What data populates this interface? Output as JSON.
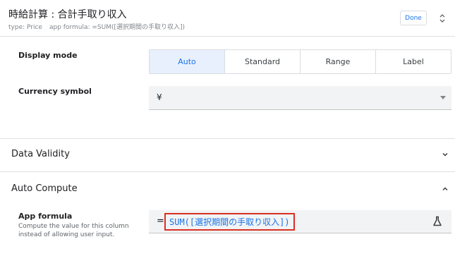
{
  "header": {
    "title": "時給計算 : 合計手取り収入",
    "type_text": "type: Price",
    "formula_text": "app formula: =SUM([選択期間の手取り収入])",
    "done_label": "Done",
    "icons": {
      "reorder": "up-down-chevron-icon"
    }
  },
  "display_mode": {
    "label": "Display mode",
    "options": [
      "Auto",
      "Standard",
      "Range",
      "Label"
    ],
    "selected": "Auto"
  },
  "currency_symbol": {
    "label": "Currency symbol",
    "value": "¥"
  },
  "sections": {
    "data_validity": {
      "title": "Data Validity",
      "state": "collapsed"
    },
    "auto_compute": {
      "title": "Auto Compute",
      "state": "expanded"
    }
  },
  "app_formula": {
    "label": "App formula",
    "help": "Compute the value for this column instead of allowing user input.",
    "equals": "=",
    "expression": "SUM([選択期間の手取り収入])",
    "icons": {
      "test": "flask-icon"
    }
  },
  "colors": {
    "accent": "#1a73e8",
    "active_bg": "#e8f0fe",
    "highlight_border": "#d93025"
  }
}
